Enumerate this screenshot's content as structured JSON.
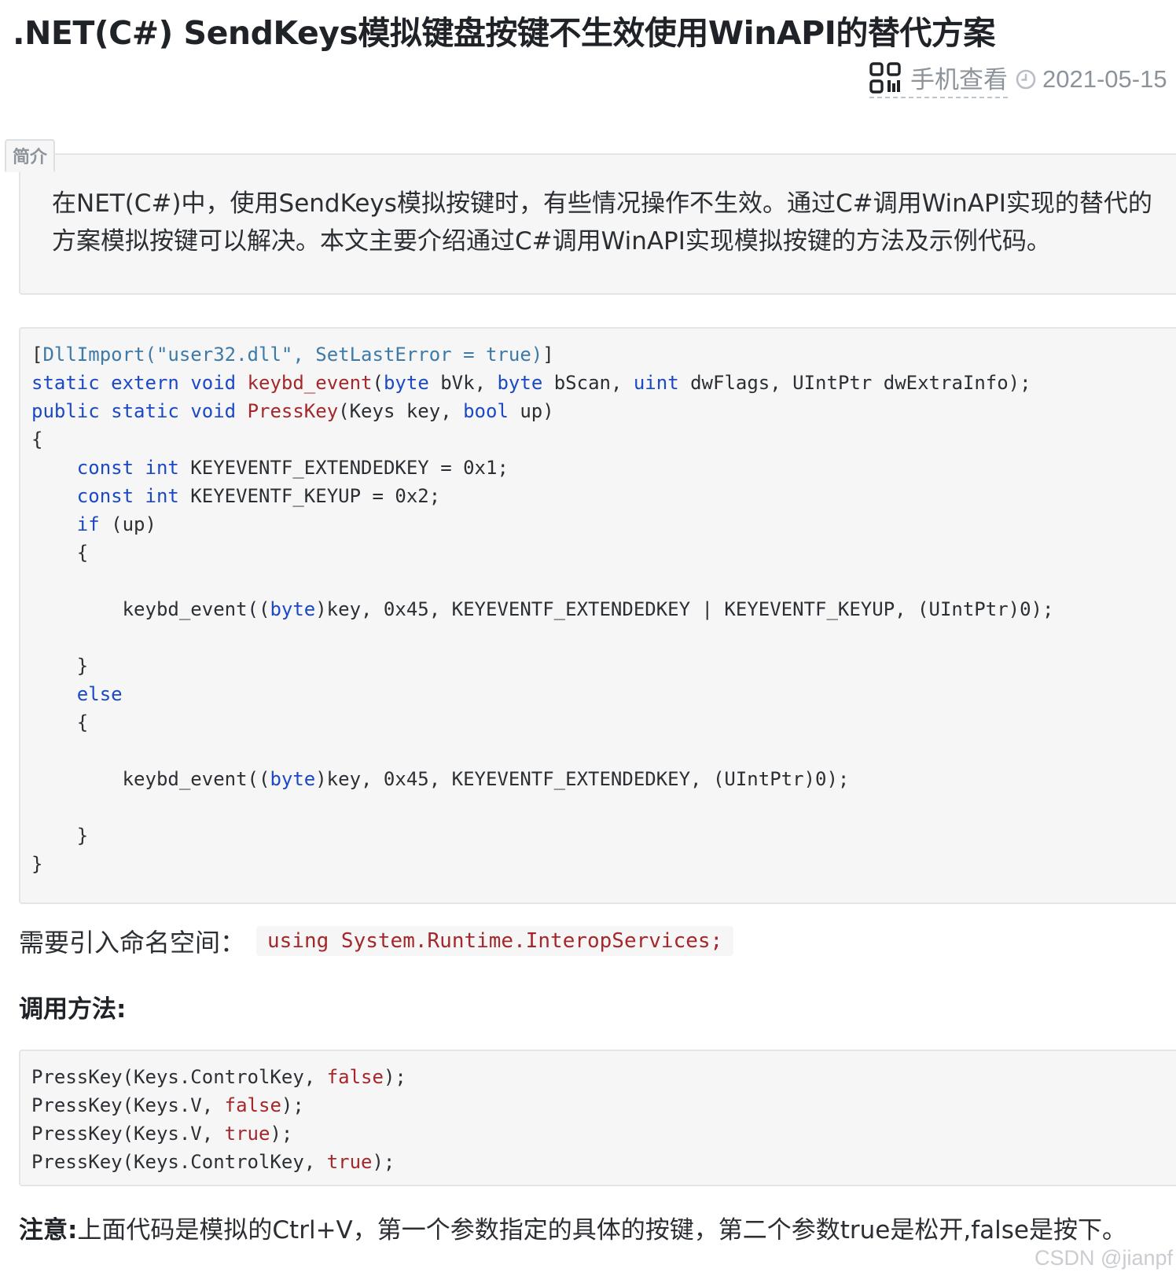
{
  "article": {
    "title": ".NET(C#) SendKeys模拟键盘按键不生效使用WinAPI的替代方案",
    "mobile_view_label": "手机查看",
    "date": "2021-05-15",
    "intro_label": "简介",
    "intro_text": "在NET(C#)中，使用SendKeys模拟按键时，有些情况操作不生效。通过C#调用WinAPI实现的替代的方案模拟按键可以解决。本文主要介绍通过C#调用WinAPI实现模拟按键的方法及示例代码。",
    "namespace_label": "需要引入命名空间：",
    "namespace_code": "using System.Runtime.InteropServices;",
    "call_heading": "调用方法:",
    "note_label": "注意:",
    "note_text": "上面代码是模拟的Ctrl+V，第一个参数指定的具体的按键，第二个参数true是松开,false是按下。",
    "watermark": "CSDN @jianpf"
  },
  "code_main": {
    "attr_open": "[",
    "attr_name": "DllImport(",
    "attr_string": "\"user32.dll\"",
    "attr_rest": ", SetLastError = true)",
    "attr_close": "]",
    "kw_static": "static",
    "kw_extern": "extern",
    "kw_void": "void",
    "kw_public": "public",
    "kw_byte": "byte",
    "kw_uint": "uint",
    "kw_bool": "bool",
    "kw_const": "const",
    "kw_int": "int",
    "kw_if": "if",
    "kw_else": "else",
    "fn_keybd_event": "keybd_event",
    "fn_presskey": "PressKey",
    "decl1_open": "(",
    "decl1_p1": " bVk, ",
    "decl1_p2": " bScan, ",
    "decl1_p3": " dwFlags, UIntPtr dwExtraInfo);",
    "decl2_p1": "(Keys key, ",
    "decl2_p2": " up)",
    "brace_open": "{",
    "brace_close": "}",
    "const1_rest": " KEYEVENTF_EXTENDEDKEY = 0x1;",
    "const2_rest": " KEYEVENTF_KEYUP = 0x2;",
    "if_rest": " (up)",
    "call_prefix": "keybd_event((",
    "call1_rest": ")key, 0x45, KEYEVENTF_EXTENDEDKEY | KEYEVENTF_KEYUP, (UIntPtr)0);",
    "call2_rest": ")key, 0x45, KEYEVENTF_EXTENDEDKEY, (UIntPtr)0);"
  },
  "code_call": {
    "l1_pre": "PressKey(Keys.ControlKey, ",
    "l2_pre": "PressKey(Keys.V, ",
    "l3_pre": "PressKey(Keys.V, ",
    "l4_pre": "PressKey(Keys.ControlKey, ",
    "v_false": "false",
    "v_true": "true",
    "end": ");"
  },
  "colors": {
    "keyword": "#1b49c6",
    "function": "#a5272a",
    "attribute": "#3d7aa8",
    "literal": "#a5272a"
  },
  "icons": [
    "qr-code-icon",
    "clock-icon"
  ]
}
